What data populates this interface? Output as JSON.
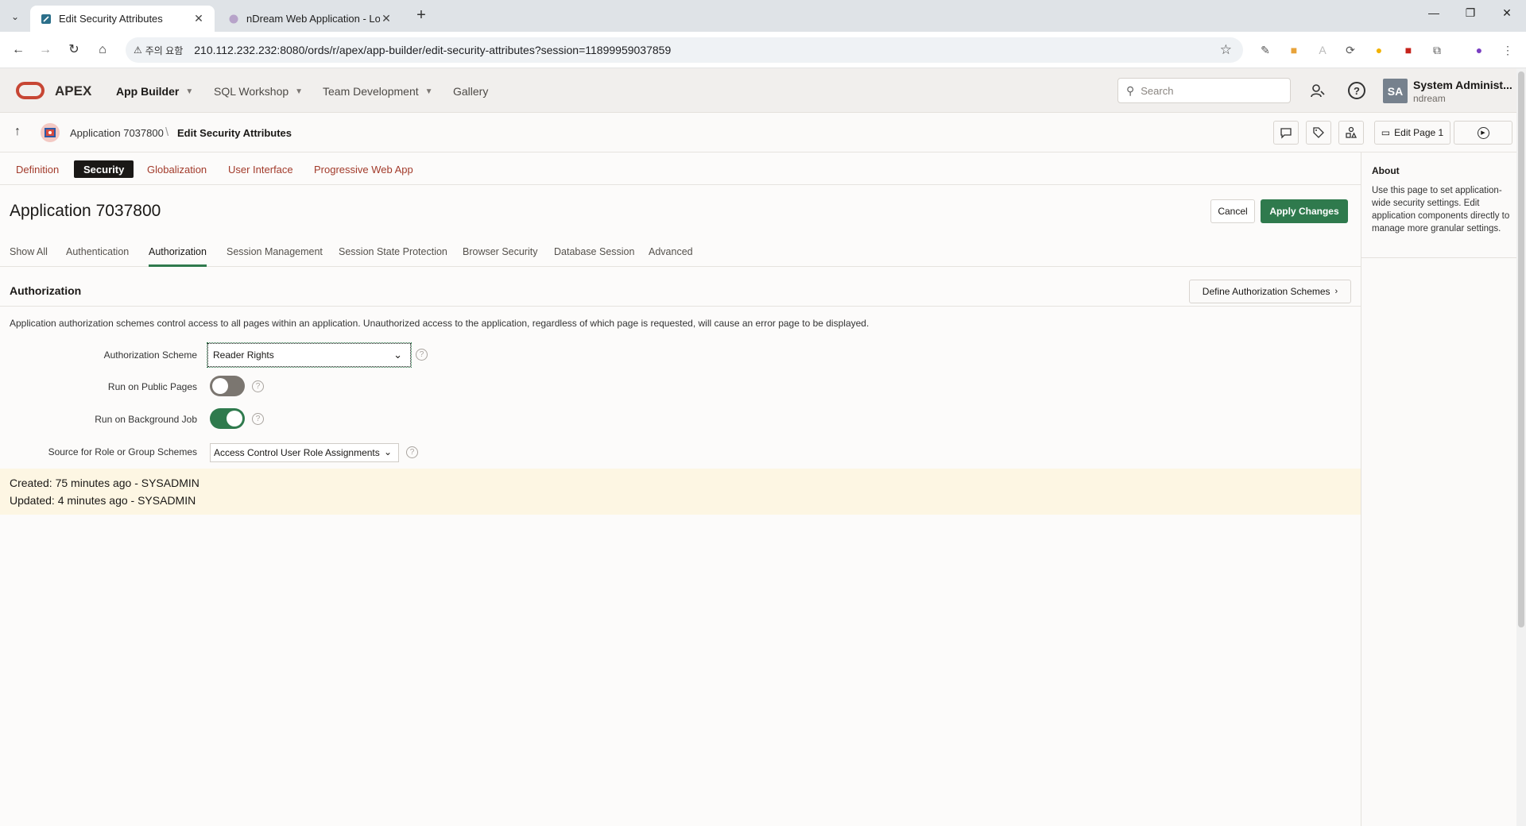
{
  "browser": {
    "tabs": [
      {
        "title": "Edit Security Attributes"
      },
      {
        "title": "nDream Web Application - Lo"
      }
    ],
    "warning_label": "주의 요함",
    "url": "210.112.232.232:8080/ords/r/apex/app-builder/edit-security-attributes?session=11899959037859"
  },
  "header": {
    "brand": "APEX",
    "nav": [
      "App Builder",
      "SQL Workshop",
      "Team Development",
      "Gallery"
    ],
    "search_placeholder": "Search",
    "user_initials": "SA",
    "user_name": "System Administ...",
    "user_workspace": "ndream"
  },
  "breadcrumb": {
    "app": "Application 7037800",
    "current": "Edit Security Attributes",
    "edit_page_label": "Edit Page 1"
  },
  "page_tabs": [
    "Definition",
    "Security",
    "Globalization",
    "User Interface",
    "Progressive Web App"
  ],
  "page_tab_active": "Security",
  "title": "Application 7037800",
  "buttons": {
    "cancel": "Cancel",
    "apply": "Apply Changes",
    "define": "Define Authorization Schemes"
  },
  "sub_tabs": [
    "Show All",
    "Authentication",
    "Authorization",
    "Session Management",
    "Session State Protection",
    "Browser Security",
    "Database Session",
    "Advanced"
  ],
  "sub_tab_active": "Authorization",
  "section": {
    "title": "Authorization",
    "description": "Application authorization schemes control access to all pages within an application. Unauthorized access to the application, regardless of which page is requested, will cause an error page to be displayed."
  },
  "form": {
    "scheme_label": "Authorization Scheme",
    "scheme_value": "Reader Rights",
    "public_label": "Run on Public Pages",
    "public_on": false,
    "background_label": "Run on Background Job",
    "background_on": true,
    "source_label": "Source for Role or Group Schemes",
    "source_value": "Access Control User Role Assignments"
  },
  "audit": {
    "created": "Created: 75 minutes ago - SYSADMIN",
    "updated": "Updated: 4 minutes ago - SYSADMIN"
  },
  "side": {
    "title": "About",
    "text": "Use this page to set application-wide security settings. Edit application components directly to manage more granular settings."
  },
  "colors": {
    "accent_green": "#2f7a4d",
    "link_red": "#a23b2b",
    "oracle_red": "#c74634"
  }
}
